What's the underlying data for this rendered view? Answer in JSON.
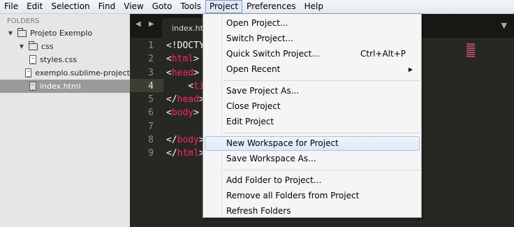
{
  "menubar": [
    "File",
    "Edit",
    "Selection",
    "Find",
    "View",
    "Goto",
    "Tools",
    "Project",
    "Preferences",
    "Help"
  ],
  "sidebar": {
    "title": "FOLDERS",
    "items": [
      {
        "label": "Projeto Exemplo",
        "type": "folder",
        "expanded": true
      },
      {
        "label": "css",
        "type": "folder",
        "expanded": true
      },
      {
        "label": "styles.css",
        "type": "file"
      },
      {
        "label": "exemplo.sublime-project",
        "type": "file"
      },
      {
        "label": "index.html",
        "type": "file",
        "selected": true
      }
    ]
  },
  "editor": {
    "tab_nav": "◀ ▶",
    "tab_label": "index.html",
    "tab_overflow": "▼",
    "active_line": 4,
    "lines": [
      {
        "num": "1",
        "parts": [
          {
            "t": "<!DOCTYPE html>",
            "c": "punct"
          }
        ]
      },
      {
        "num": "2",
        "parts": [
          {
            "t": "<",
            "c": "punct"
          },
          {
            "t": "html",
            "c": "tag"
          },
          {
            "t": ">",
            "c": "punct"
          }
        ]
      },
      {
        "num": "3",
        "parts": [
          {
            "t": "<",
            "c": "punct"
          },
          {
            "t": "head",
            "c": "tag"
          },
          {
            "t": ">",
            "c": "punct"
          }
        ]
      },
      {
        "num": "4",
        "parts": [
          {
            "t": "    <",
            "c": "punct"
          },
          {
            "t": "title",
            "c": "tag"
          },
          {
            "t": ">",
            "c": "punct"
          }
        ]
      },
      {
        "num": "5",
        "parts": [
          {
            "t": "</",
            "c": "punct"
          },
          {
            "t": "head",
            "c": "tag"
          },
          {
            "t": ">",
            "c": "punct"
          }
        ]
      },
      {
        "num": "6",
        "parts": [
          {
            "t": "<",
            "c": "punct"
          },
          {
            "t": "body",
            "c": "tag"
          },
          {
            "t": ">",
            "c": "punct"
          }
        ]
      },
      {
        "num": "7",
        "parts": []
      },
      {
        "num": "8",
        "parts": [
          {
            "t": "</",
            "c": "punct"
          },
          {
            "t": "body",
            "c": "tag"
          },
          {
            "t": ">",
            "c": "punct"
          }
        ]
      },
      {
        "num": "9",
        "parts": [
          {
            "t": "</",
            "c": "punct"
          },
          {
            "t": "html",
            "c": "tag"
          },
          {
            "t": ">",
            "c": "punct"
          }
        ]
      }
    ]
  },
  "project_menu": {
    "items": [
      {
        "label": "Open Project...",
        "shortcut": "",
        "submenu": false
      },
      {
        "label": "Switch Project...",
        "shortcut": "",
        "submenu": false
      },
      {
        "label": "Quick Switch Project...",
        "shortcut": "Ctrl+Alt+P",
        "submenu": false
      },
      {
        "label": "Open Recent",
        "shortcut": "",
        "submenu": true
      },
      {
        "separator": true
      },
      {
        "label": "Save Project As...",
        "shortcut": "",
        "submenu": false
      },
      {
        "label": "Close Project",
        "shortcut": "",
        "submenu": false
      },
      {
        "label": "Edit Project",
        "shortcut": "",
        "submenu": false
      },
      {
        "separator": true
      },
      {
        "label": "New Workspace for Project",
        "shortcut": "",
        "submenu": false,
        "hover": true
      },
      {
        "label": "Save Workspace As...",
        "shortcut": "",
        "submenu": false
      },
      {
        "separator": true
      },
      {
        "label": "Add Folder to Project...",
        "shortcut": "",
        "submenu": false
      },
      {
        "label": "Remove all Folders from Project",
        "shortcut": "",
        "submenu": false
      },
      {
        "label": "Refresh Folders",
        "shortcut": "",
        "submenu": false
      }
    ]
  },
  "colors": {
    "tag": "#f92672",
    "editor_bg": "#272822",
    "sidebar_bg": "#e6e6e6",
    "selected_row": "#9a9a9a"
  }
}
